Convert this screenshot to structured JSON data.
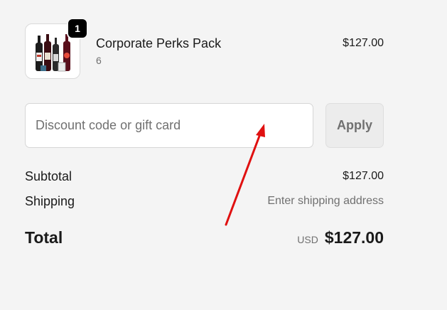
{
  "product": {
    "name": "Corporate Perks Pack",
    "variant": "6",
    "price": "$127.00",
    "quantity_badge": "1",
    "image_icon": "wine-bottles-image"
  },
  "discount": {
    "placeholder": "Discount code or gift card",
    "value": "",
    "apply_label": "Apply"
  },
  "summary": {
    "subtotal_label": "Subtotal",
    "subtotal_value": "$127.00",
    "shipping_label": "Shipping",
    "shipping_value": "Enter shipping address",
    "total_label": "Total",
    "currency": "USD",
    "total_value": "$127.00"
  },
  "annotation": {
    "icon": "red-arrow-icon",
    "color": "#e01010"
  }
}
